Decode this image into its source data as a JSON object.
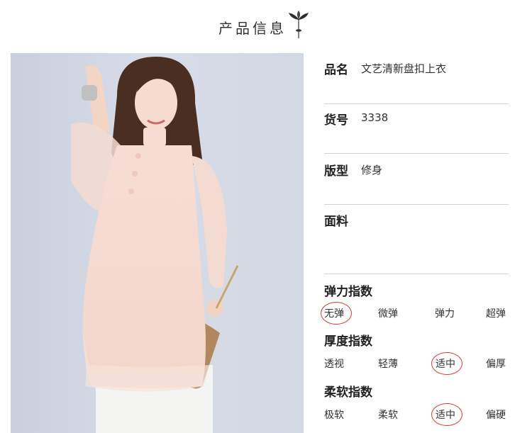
{
  "header": {
    "title": "产品信息",
    "icon": "lotus-icon"
  },
  "product": {
    "name_label": "品名",
    "name_value": "文艺清新盘扣上衣",
    "sku_label": "货号",
    "sku_value": "3338",
    "fit_label": "版型",
    "fit_value": "修身",
    "fabric_label": "面料"
  },
  "elasticity": {
    "label": "弹力指数",
    "options": [
      "无弹",
      "微弹",
      "弹力",
      "超弹"
    ],
    "selected": "无弹"
  },
  "thickness": {
    "label": "厚度指数",
    "options": [
      "透视",
      "轻薄",
      "适中",
      "偏厚"
    ],
    "selected": "适中"
  },
  "softness": {
    "label": "柔软指数",
    "options": [
      "极软",
      "柔软",
      "适中",
      "偏硬"
    ],
    "selected": "适中"
  },
  "colors": {
    "highlight": "#d03a3a",
    "divider": "#d2d2d2"
  }
}
